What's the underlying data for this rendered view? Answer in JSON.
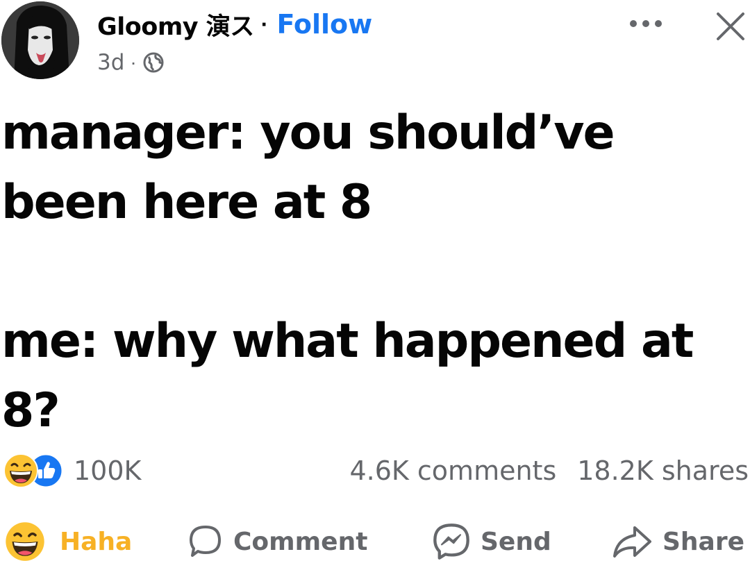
{
  "header": {
    "author_name": "Gloomy 演ス",
    "separator": "·",
    "follow_label": "Follow",
    "timestamp": "3d",
    "meta_separator": "·",
    "privacy_icon": "globe-icon",
    "more_icon": "more-horizontal-icon",
    "close_icon": "close-icon"
  },
  "post": {
    "lines": [
      "manager: you should’ve",
      "been here at 8",
      "",
      "me: why what happened at",
      "8?"
    ]
  },
  "reactions": {
    "icons": [
      "haha-reaction-icon",
      "like-reaction-icon"
    ],
    "count": "100K"
  },
  "engagement": {
    "comments": "4.6K comments",
    "shares": "18.2K shares"
  },
  "actions": {
    "haha_label": "Haha",
    "comment_label": "Comment",
    "send_label": "Send",
    "share_label": "Share"
  },
  "colors": {
    "text": "#050505",
    "secondary": "#65676b",
    "link": "#1877f2",
    "haha": "#f7b125"
  }
}
